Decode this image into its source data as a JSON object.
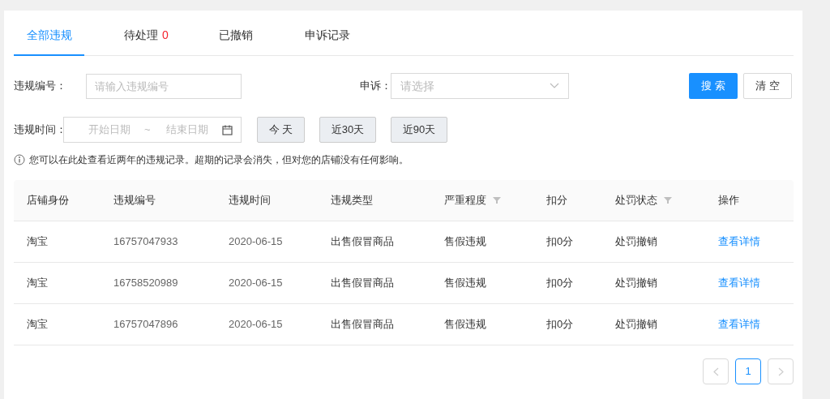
{
  "tabs": [
    {
      "label": "全部违规",
      "selected": true
    },
    {
      "label": "待处理",
      "count": "0",
      "selected": false
    },
    {
      "label": "已撤销",
      "selected": false
    },
    {
      "label": "申诉记录",
      "selected": false
    }
  ],
  "filters": {
    "id_label": "违规编号：",
    "id_placeholder": "请输入违规编号",
    "appeal_label": "申诉：",
    "appeal_placeholder": "请选择",
    "time_label": "违规时间：",
    "start_placeholder": "开始日期",
    "range_separator": "~",
    "end_placeholder": "结束日期",
    "quick_ranges": [
      "今 天",
      "近30天",
      "近90天"
    ],
    "search_button": "搜 索",
    "clear_button": "清 空"
  },
  "notice": "您可以在此处查看近两年的违规记录。超期的记录会消失，但对您的店铺没有任何影响。",
  "table": {
    "columns": [
      {
        "label": "店铺身份",
        "filter": false
      },
      {
        "label": "违规编号",
        "filter": false
      },
      {
        "label": "违规时间",
        "filter": false
      },
      {
        "label": "违规类型",
        "filter": false
      },
      {
        "label": "严重程度",
        "filter": true
      },
      {
        "label": "扣分",
        "filter": false
      },
      {
        "label": "处罚状态",
        "filter": true
      },
      {
        "label": "操作",
        "filter": false
      }
    ],
    "rows": [
      [
        "淘宝",
        "16757047933",
        "2020-06-15",
        "出售假冒商品",
        "售假违规",
        "扣0分",
        "处罚撤销",
        "查看详情"
      ],
      [
        "淘宝",
        "16758520989",
        "2020-06-15",
        "出售假冒商品",
        "售假违规",
        "扣0分",
        "处罚撤销",
        "查看详情"
      ],
      [
        "淘宝",
        "16757047896",
        "2020-06-15",
        "出售假冒商品",
        "售假违规",
        "扣0分",
        "处罚撤销",
        "查看详情"
      ]
    ]
  },
  "pagination": {
    "pages": [
      {
        "label": "1",
        "selected": true
      }
    ]
  }
}
